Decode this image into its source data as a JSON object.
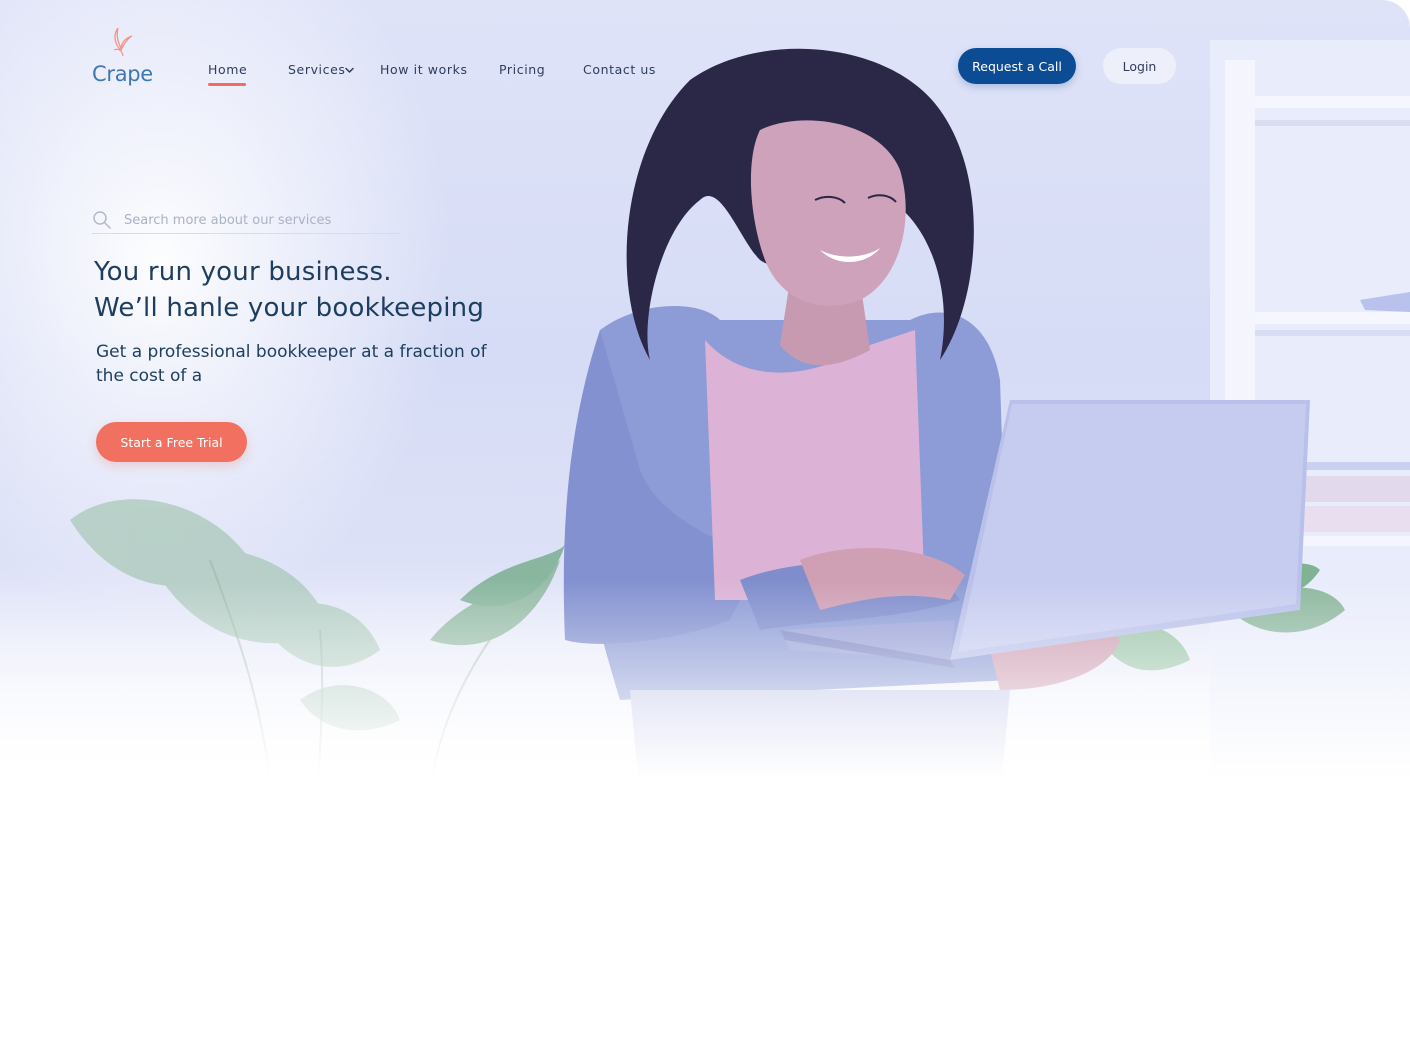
{
  "brand": {
    "name": "Crape",
    "accent": "#f26b5f",
    "primary": "#0c4c94"
  },
  "nav": {
    "items": [
      {
        "label": "Home",
        "active": true
      },
      {
        "label": "Services",
        "has_dropdown": true
      },
      {
        "label": "How it works"
      },
      {
        "label": "Pricing"
      },
      {
        "label": "Contact us"
      }
    ]
  },
  "header_actions": {
    "request_call": "Request a Call",
    "login": "Login"
  },
  "search": {
    "placeholder": "Search more about our services",
    "value": "",
    "icon": "search-icon"
  },
  "hero": {
    "headline_line1": "You run your business.",
    "headline_line2": "We’ll hanle your bookkeeping",
    "subtext": "Get a professional bookkeeper at a fraction of the cost of a",
    "cta": "Start a Free Trial"
  }
}
